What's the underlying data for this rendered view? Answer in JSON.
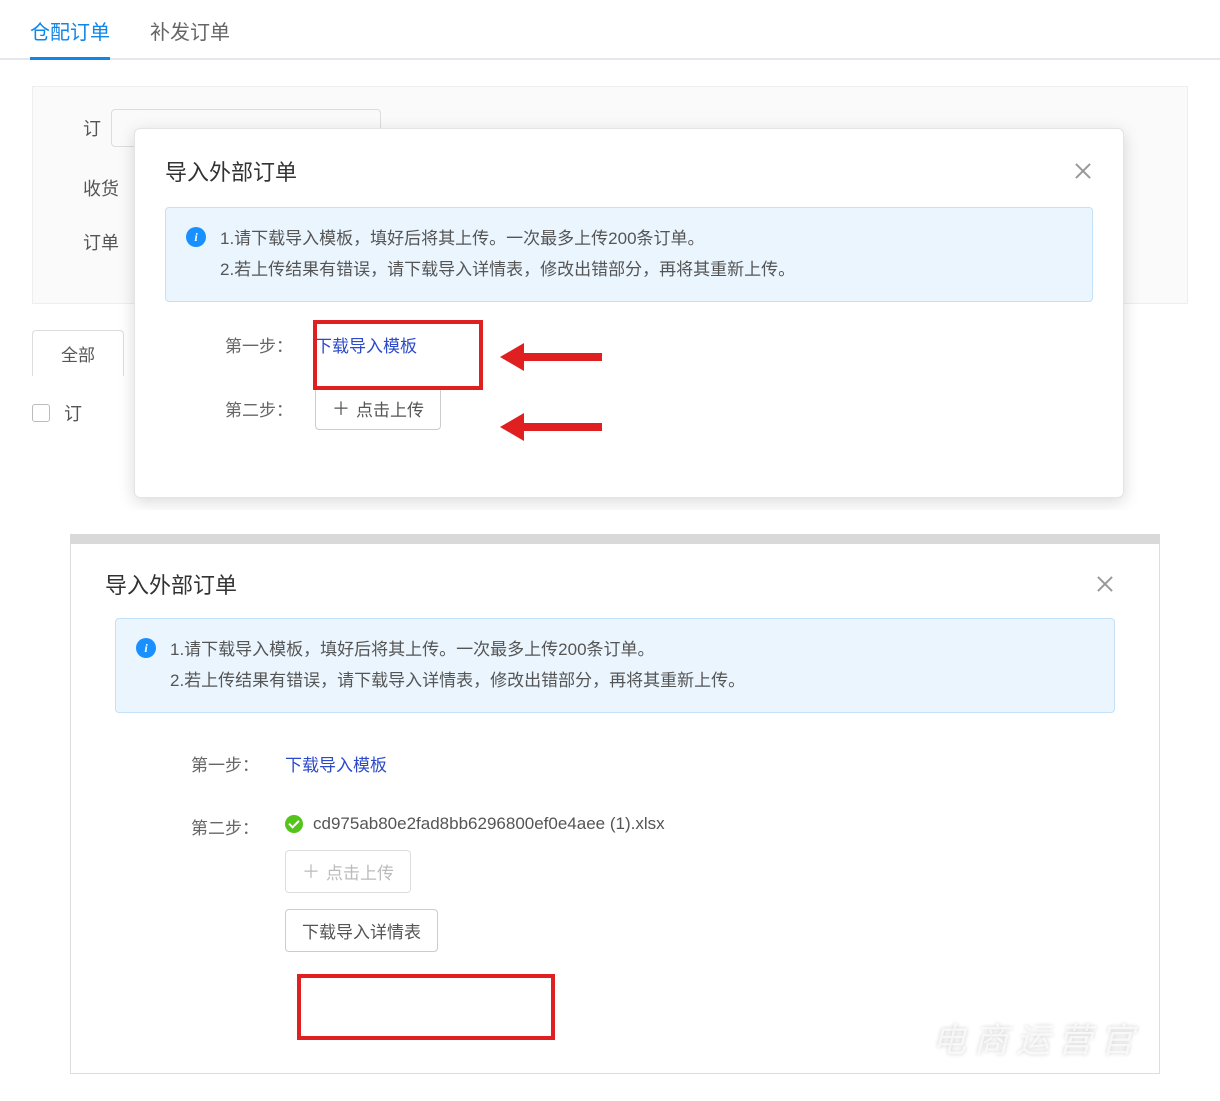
{
  "tabs": {
    "active": "仓配订单",
    "other": "补发订单"
  },
  "form": {
    "label1_partial": "订",
    "label2": "收货",
    "label3": "订单",
    "input_partial": ""
  },
  "filter_tab": "全部",
  "checkbox_label_partial": "订",
  "modal1": {
    "title": "导入外部订单",
    "info_line1": "1.请下载导入模板，填好后将其上传。一次最多上传200条订单。",
    "info_line2": "2.若上传结果有错误，请下载导入详情表，修改出错部分，再将其重新上传。",
    "step1_label": "第一步：",
    "step1_link": "下载导入模板",
    "step2_label": "第二步：",
    "step2_btn": "点击上传"
  },
  "modal2": {
    "title": "导入外部订单",
    "info_line1": "1.请下载导入模板，填好后将其上传。一次最多上传200条订单。",
    "info_line2": "2.若上传结果有错误，请下载导入详情表，修改出错部分，再将其重新上传。",
    "step1_label": "第一步：",
    "step1_link": "下载导入模板",
    "step2_label": "第二步：",
    "file_name": "cd975ab80e2fad8bb6296800ef0e4aee (1).xlsx",
    "upload_btn": "点击上传",
    "detail_btn": "下载导入详情表"
  },
  "watermark": "电商运营官"
}
